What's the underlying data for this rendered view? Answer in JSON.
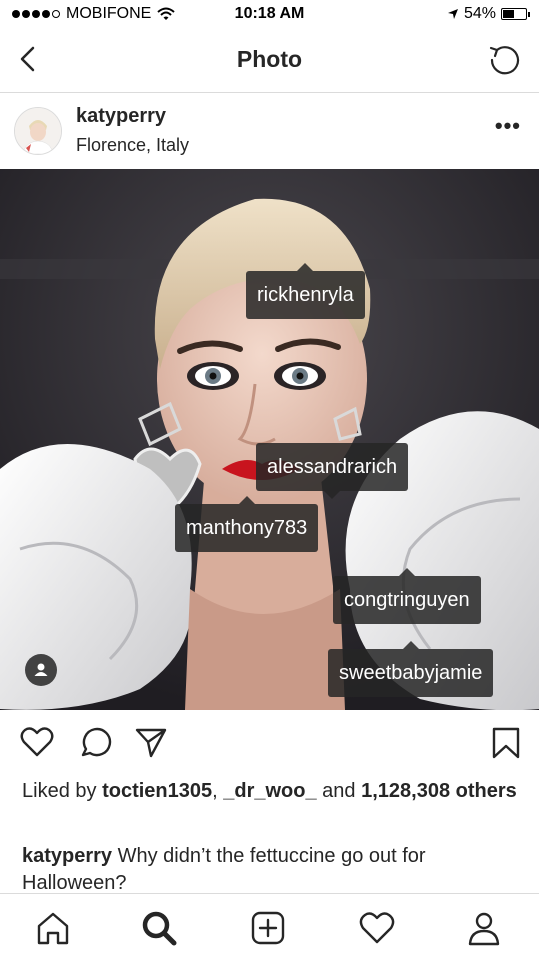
{
  "status_bar": {
    "carrier": "MOBIFONE",
    "time": "10:18 AM",
    "battery_percent": "54%",
    "battery_level": 0.54,
    "signal_bars_filled": 4,
    "signal_bars_total": 5,
    "icons": [
      "wifi-icon",
      "location-arrow-icon",
      "battery-icon"
    ]
  },
  "nav": {
    "title": "Photo",
    "back_icon": "chevron-left-icon",
    "refresh_icon": "refresh-icon"
  },
  "post": {
    "username": "katyperry",
    "location": "Florence, Italy",
    "more_icon": "more-horizontal-icon",
    "more_label": "•••"
  },
  "photo": {
    "tags": [
      {
        "label": "rickhenryla"
      },
      {
        "label": "alessandrarich"
      },
      {
        "label": "manthony783"
      },
      {
        "label": "congtringuyen"
      },
      {
        "label": "sweetbabyjamie"
      }
    ],
    "user_tag_icon": "person-icon"
  },
  "actions": {
    "like_icon": "heart-icon",
    "comment_icon": "comment-icon",
    "share_icon": "send-icon",
    "save_icon": "bookmark-icon"
  },
  "likes": {
    "prefix": "Liked by ",
    "user1": "toctien1305",
    "sep": ", ",
    "user2": "_dr_woo_",
    "and": " and ",
    "count": "1,128,308 others"
  },
  "caption": {
    "username": "katyperry",
    "text": " Why didn’t the fettuccine go out for Halloween?"
  },
  "tab_bar": {
    "items": [
      "home-icon",
      "search-icon",
      "add-icon",
      "activity-heart-icon",
      "profile-icon"
    ]
  },
  "colors": {
    "text": "#262626",
    "divider": "#dbdbdb",
    "tag_bg": "#262626"
  }
}
